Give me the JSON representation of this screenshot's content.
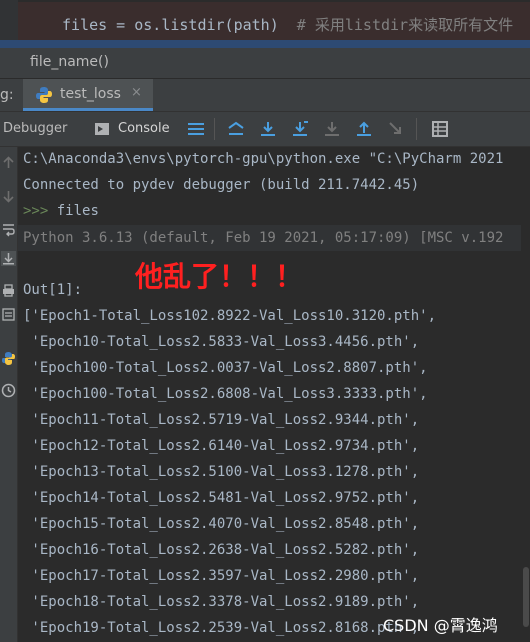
{
  "editor": {
    "code": "files = os.listdir(path)",
    "comment": "  # 采用listdir来读取所有文件"
  },
  "breadcrumb": {
    "text": "file_name()"
  },
  "runbar": {
    "prefix": "g:",
    "tab_label": "test_loss",
    "close_glyph": "×"
  },
  "toolbar": {
    "debugger_label": "Debugger",
    "console_label": "Console",
    "icons": [
      "menu-icon",
      "show-execution-point-icon",
      "step-over-icon",
      "step-into-icon",
      "step-into-my-code-icon",
      "step-out-icon",
      "run-to-cursor-icon",
      "evaluate-icon",
      "frames-table-icon"
    ]
  },
  "console": {
    "lines": [
      "C:\\Anaconda3\\envs\\pytorch-gpu\\python.exe \"C:\\PyCharm 2021",
      "Connected to pydev debugger (build 211.7442.45)"
    ],
    "prompt": ">>>",
    "prompt_cmd": " files",
    "info": "Python 3.6.13 (default, Feb 19 2021, 05:17:09) [MSC v.192",
    "out_label": "Out[1]:",
    "output": [
      "['Epoch1-Total_Loss102.8922-Val_Loss10.3120.pth',",
      " 'Epoch10-Total_Loss2.5833-Val_Loss3.4456.pth',",
      " 'Epoch100-Total_Loss2.0037-Val_Loss2.8807.pth',",
      " 'Epoch100-Total_Loss2.6808-Val_Loss3.3333.pth',",
      " 'Epoch11-Total_Loss2.5719-Val_Loss2.9344.pth',",
      " 'Epoch12-Total_Loss2.6140-Val_Loss2.9734.pth',",
      " 'Epoch13-Total_Loss2.5100-Val_Loss3.1278.pth',",
      " 'Epoch14-Total_Loss2.5481-Val_Loss2.9752.pth',",
      " 'Epoch15-Total_Loss2.4070-Val_Loss2.8548.pth',",
      " 'Epoch16-Total_Loss2.2638-Val_Loss2.5282.pth',",
      " 'Epoch17-Total_Loss2.3597-Val_Loss2.2980.pth',",
      " 'Epoch18-Total_Loss2.3378-Val_Loss2.9189.pth',",
      " 'Epoch19-Total_Loss2.2539-Val_Loss2.8168.pth',"
    ]
  },
  "annotation": "他乱了！！！",
  "watermark": "CSDN @霄逸鸿",
  "colors": {
    "annotation": "#ff2020",
    "prompt": "#6a8759",
    "tab_underline": "#4a88c7",
    "text": "#a9b7c6"
  }
}
